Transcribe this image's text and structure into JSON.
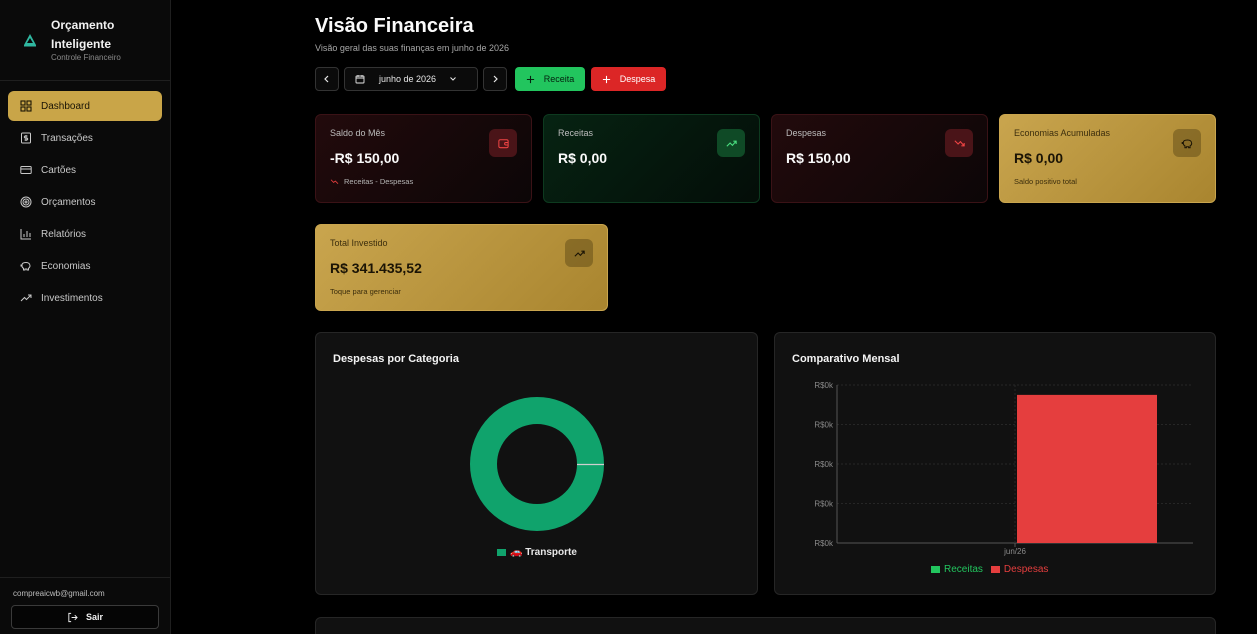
{
  "sidebar": {
    "brand_title": "Orçamento Inteligente",
    "brand_subtitle": "Controle Financeiro",
    "items": [
      {
        "label": "Dashboard",
        "icon": "dashboard-icon",
        "active": true
      },
      {
        "label": "Transações",
        "icon": "dollar-icon"
      },
      {
        "label": "Cartões",
        "icon": "credit-card-icon"
      },
      {
        "label": "Orçamentos",
        "icon": "target-icon"
      },
      {
        "label": "Relatórios",
        "icon": "bar-chart-icon"
      },
      {
        "label": "Economias",
        "icon": "piggy-bank-icon"
      },
      {
        "label": "Investimentos",
        "icon": "trending-up-icon"
      }
    ],
    "user_email": "compreaicwb@gmail.com",
    "logout_label": "Sair"
  },
  "header": {
    "title": "Visão Financeira",
    "subtitle": "Visão geral das suas finanças em junho de 2026",
    "month_label": "junho de 2026",
    "income_button": "Receita",
    "expense_button": "Despesa"
  },
  "cards": {
    "balance": {
      "label": "Saldo do Mês",
      "value": "-R$ 150,00",
      "note": "Receitas - Despesas"
    },
    "income": {
      "label": "Receitas",
      "value": "R$ 0,00"
    },
    "expenses": {
      "label": "Despesas",
      "value": "R$ 150,00"
    },
    "savings": {
      "label": "Economias Acumuladas",
      "value": "R$ 0,00",
      "note": "Saldo positivo total"
    },
    "invested": {
      "label": "Total Investido",
      "value": "R$ 341.435,52",
      "note": "Toque para gerenciar"
    }
  },
  "colors": {
    "accent_gold": "#c9a548",
    "income_green": "#22c55e",
    "expense_red": "#e53e3e",
    "donut_green": "#10a36c"
  },
  "chart_data": [
    {
      "type": "pie",
      "title": "Despesas por Categoria",
      "categories": [
        "🚗 Transporte"
      ],
      "values": [
        150
      ],
      "legend": "bottom"
    },
    {
      "type": "bar",
      "title": "Comparativo Mensal",
      "categories": [
        "jun/26"
      ],
      "series": [
        {
          "name": "Receitas",
          "values": [
            0
          ]
        },
        {
          "name": "Despesas",
          "values": [
            150
          ]
        }
      ],
      "y_tick_labels": [
        "R$0k",
        "R$0k",
        "R$0k",
        "R$0k",
        "R$0k"
      ],
      "ylim": [
        0,
        160
      ],
      "grid": true,
      "legend": "bottom"
    }
  ]
}
